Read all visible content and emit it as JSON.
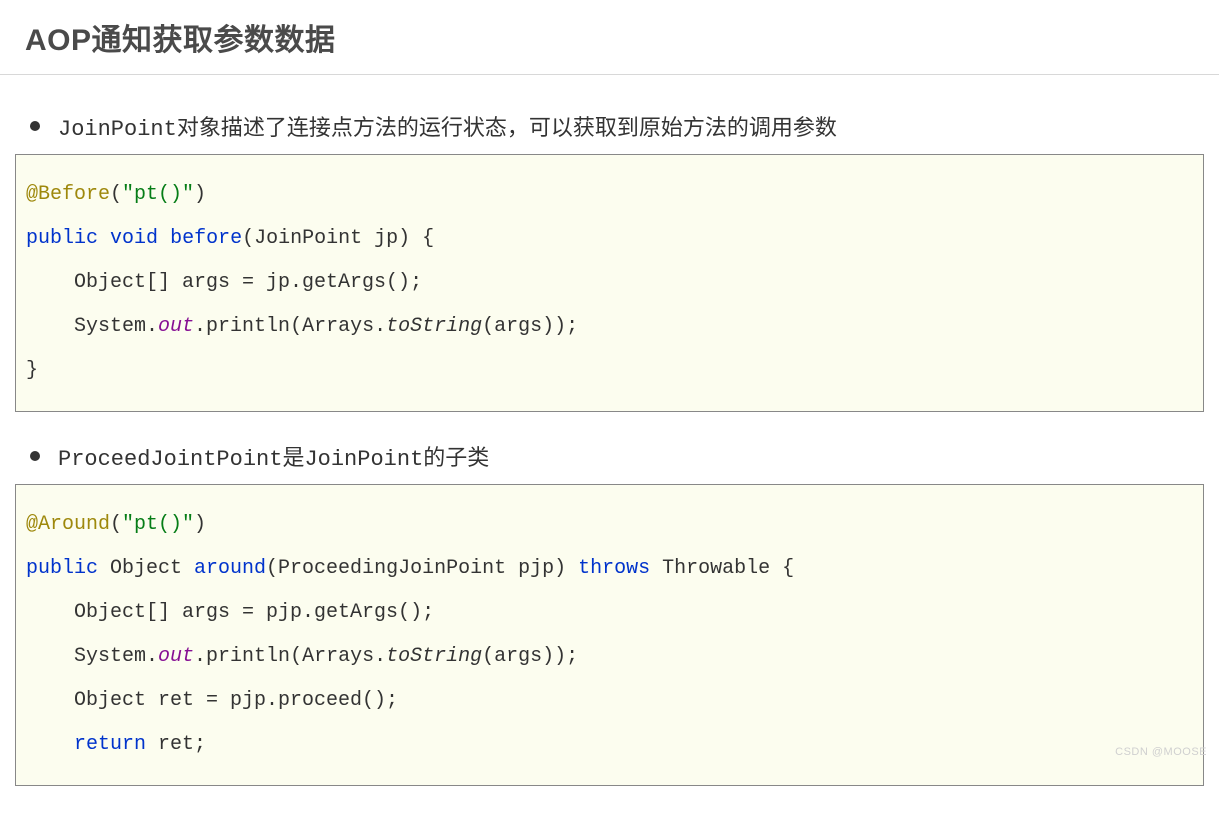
{
  "header": {
    "title": "AOP通知获取参数数据"
  },
  "bullets": {
    "item1_prefix_mono": "JoinPoint",
    "item1_rest": "对象描述了连接点方法的运行状态，可以获取到原始方法的调用参数",
    "item2_prefix_mono": "ProceedJointPoint",
    "item2_mid": "是",
    "item2_mono2": "JoinPoint",
    "item2_tail": "的子类"
  },
  "code1": {
    "anno_name": "@Before",
    "anno_arg": "\"pt()\"",
    "kw_public": "public",
    "kw_void": "void",
    "fn_before": "before",
    "params": "(JoinPoint jp) {",
    "line2": "    Object[] args = jp.getArgs();",
    "line3a": "    System.",
    "line3_out": "out",
    "line3b": ".println(Arrays.",
    "line3_tostring": "toString",
    "line3c": "(args));",
    "line4": "}"
  },
  "code2": {
    "anno_name": "@Around",
    "anno_arg": "\"pt()\"",
    "kw_public": "public",
    "ret_type": " Object ",
    "fn_around": "around",
    "params1": "(ProceedingJoinPoint pjp) ",
    "kw_throws": "throws",
    "params2": " Throwable {",
    "line2": "    Object[] args = pjp.getArgs();",
    "line3a": "    System.",
    "line3_out": "out",
    "line3b": ".println(Arrays.",
    "line3_tostring": "toString",
    "line3c": "(args));",
    "line4": "    Object ret = pjp.proceed();",
    "line5a": "    ",
    "kw_return": "return",
    "line5b": " ret;"
  },
  "watermark": "CSDN @MOOSE"
}
